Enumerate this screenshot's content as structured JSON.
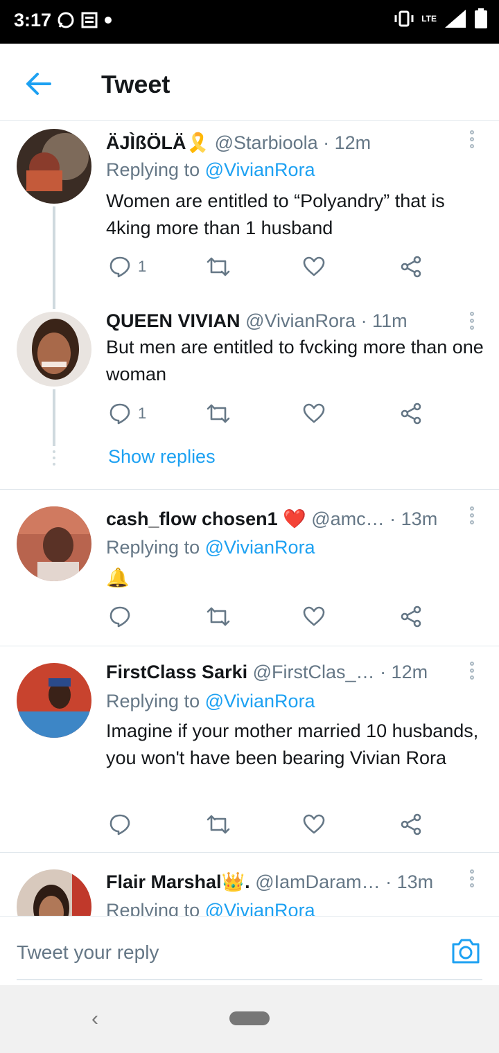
{
  "status_bar": {
    "time": "3:17",
    "network": "LTE"
  },
  "app_bar": {
    "title": "Tweet"
  },
  "tweets": [
    {
      "name": "ÄJÌßÖLÄ🎗️",
      "handle": "@Starbioola",
      "time": "· 12m",
      "replying_prefix": "Replying to ",
      "replying_to": "@VivianRora",
      "text": "Women are entitled to “Polyandry” that is 4king more than 1 husband",
      "reply_count": "1"
    },
    {
      "name": "QUEEN VIVIAN",
      "handle": "@VivianRora",
      "time": "· 11m",
      "text": "But men are entitled to fvcking more than one woman",
      "reply_count": "1",
      "show_replies": "Show replies"
    },
    {
      "name": "cash_flow chosen1 ❤️",
      "handle": "@amc…",
      "time": "· 13m",
      "replying_prefix": "Replying to ",
      "replying_to": "@VivianRora",
      "text": "🔔"
    },
    {
      "name": "FirstClass Sarki",
      "handle": "@FirstClas_…",
      "time": "· 12m",
      "replying_prefix": "Replying to ",
      "replying_to": "@VivianRora",
      "text": "Imagine if your mother married 10 husbands, you won't have been bearing Vivian Rora"
    },
    {
      "name": "Flair Marshal👑.",
      "handle": "@IamDaram…",
      "time": "· 13m",
      "replying_prefix": "Replying to ",
      "replying_to": "@VivianRora"
    }
  ],
  "reply_bar": {
    "placeholder": "Tweet your reply"
  },
  "colors": {
    "accent": "#1da1f2",
    "text": "#14171a",
    "muted": "#657786",
    "divider": "#e1e8ed"
  }
}
